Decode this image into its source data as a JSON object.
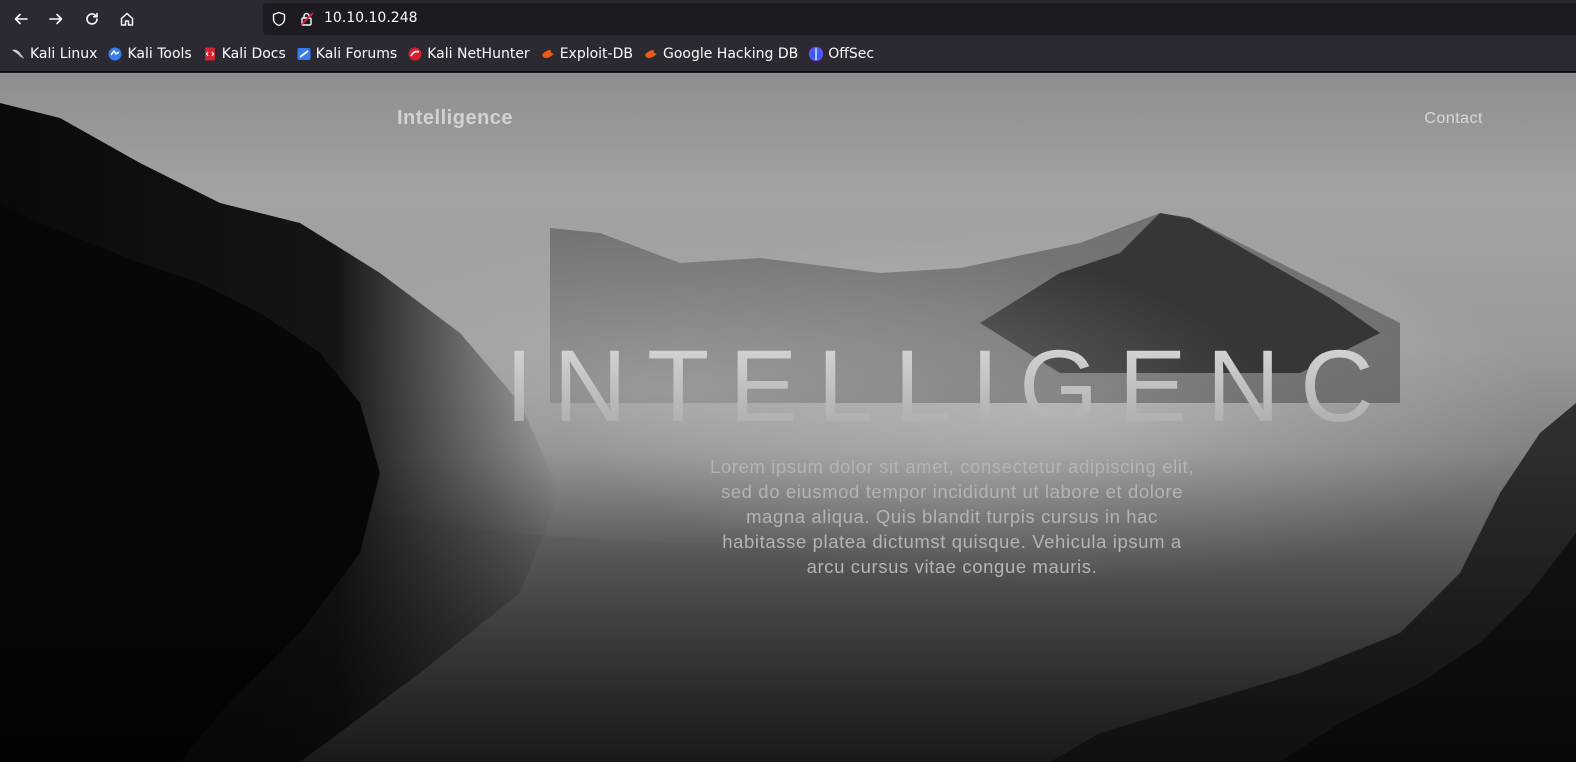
{
  "browser": {
    "url": "10.10.10.248",
    "bookmarks": [
      {
        "label": "Kali Linux",
        "icon": "kali-dragon-icon"
      },
      {
        "label": "Kali Tools",
        "icon": "kali-tools-icon"
      },
      {
        "label": "Kali Docs",
        "icon": "kali-docs-icon"
      },
      {
        "label": "Kali Forums",
        "icon": "kali-forums-icon"
      },
      {
        "label": "Kali NetHunter",
        "icon": "kali-nethunter-icon"
      },
      {
        "label": "Exploit-DB",
        "icon": "exploit-db-icon"
      },
      {
        "label": "Google Hacking DB",
        "icon": "google-hacking-db-icon"
      },
      {
        "label": "OffSec",
        "icon": "offsec-icon"
      }
    ]
  },
  "site": {
    "brand": "Intelligence",
    "nav_contact": "Contact",
    "hero_title": "INTELLIGENCE",
    "hero_text": "Lorem ipsum dolor sit amet, consectetur adipiscing elit, sed do eiusmod tempor incididunt ut labore et dolore magna aliqua. Quis blandit turpis cursus in hac habitasse platea dictumst quisque. Vehicula ipsum a arcu cursus vitae congue mauris."
  },
  "colors": {
    "chrome_bg": "#2b2a33",
    "urlbar_bg": "#1c1b22",
    "chrome_text": "#fbfbfe"
  }
}
